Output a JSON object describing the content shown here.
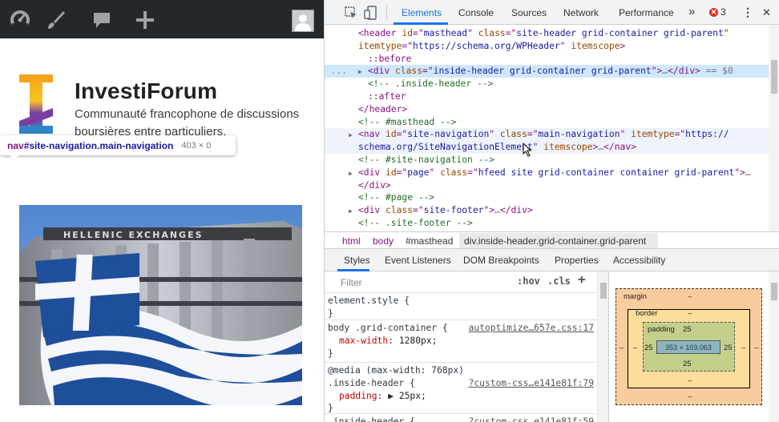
{
  "admin_bar": {
    "icons": [
      "dashboard-icon",
      "customize-brush-icon",
      "comments-icon",
      "new-content-plus-icon"
    ],
    "avatar": "user-avatar"
  },
  "site": {
    "title": "InvestiForum",
    "description": "Communauté francophone de discussions boursières entre particuliers."
  },
  "inspect_tooltip": {
    "tag": "nav",
    "selector": "#site-navigation.main-navigation",
    "dimensions": "403 × 0"
  },
  "hero_image": {
    "building_text": "HELLENIC EXCHANGES",
    "colors": {
      "flag_blue": "#1f4e9a",
      "flag_white": "#f4f6fa",
      "sky": "#6a9ad8"
    }
  },
  "devtools": {
    "tabs": [
      "Elements",
      "Console",
      "Sources",
      "Network",
      "Performance"
    ],
    "active_tab": "Elements",
    "more_label": "»",
    "error_count": "3",
    "menu_label": "⋮",
    "close_label": "✕",
    "dom_lines": [
      {
        "i": 0,
        "tri": "",
        "parts": [
          [
            "t",
            "<header "
          ],
          [
            "a",
            "id"
          ],
          [
            "t",
            "=\""
          ],
          [
            "v",
            "masthead"
          ],
          [
            "t",
            "\" "
          ],
          [
            "a",
            "class"
          ],
          [
            "t",
            "=\""
          ],
          [
            "v",
            "site-header grid-container grid-parent"
          ],
          [
            "t",
            "\""
          ]
        ]
      },
      {
        "i": 0,
        "tri": "",
        "parts": [
          [
            "a",
            "itemtype"
          ],
          [
            "t",
            "=\""
          ],
          [
            "v",
            "https://schema.org/WPHeader"
          ],
          [
            "t",
            "\" "
          ],
          [
            "a",
            "itemscope"
          ],
          [
            "t",
            ">"
          ]
        ]
      },
      {
        "i": 1,
        "tri": "",
        "parts": [
          [
            "p",
            "::before"
          ]
        ]
      },
      {
        "i": 1,
        "tri": "▶",
        "parts": [
          [
            "t",
            "<div "
          ],
          [
            "a",
            "class"
          ],
          [
            "t",
            "=\""
          ],
          [
            "v",
            "inside-header grid-container grid-parent"
          ],
          [
            "t",
            "\">"
          ],
          [
            "g",
            "…"
          ],
          [
            "t",
            "</div>"
          ],
          [
            "g",
            " == $0"
          ]
        ]
      },
      {
        "i": 1,
        "tri": "",
        "parts": [
          [
            "c",
            "<!-- .inside-header -->"
          ]
        ]
      },
      {
        "i": 1,
        "tri": "",
        "parts": [
          [
            "p",
            "::after"
          ]
        ]
      },
      {
        "i": 0,
        "tri": "",
        "parts": [
          [
            "t",
            "</header>"
          ]
        ]
      },
      {
        "i": 0,
        "tri": "",
        "parts": [
          [
            "c",
            "<!-- #masthead -->"
          ]
        ]
      },
      {
        "i": 0,
        "tri": "▶",
        "parts": [
          [
            "t",
            "<nav "
          ],
          [
            "a",
            "id"
          ],
          [
            "t",
            "=\""
          ],
          [
            "v",
            "site-navigation"
          ],
          [
            "t",
            "\" "
          ],
          [
            "a",
            "class"
          ],
          [
            "t",
            "=\""
          ],
          [
            "v",
            "main-navigation"
          ],
          [
            "t",
            "\" "
          ],
          [
            "a",
            "itemtype"
          ],
          [
            "t",
            "=\""
          ],
          [
            "v",
            "https://"
          ]
        ]
      },
      {
        "i": 0,
        "tri": "",
        "parts": [
          [
            "v",
            "schema.org/SiteNavigationElement"
          ],
          [
            "t",
            "\" "
          ],
          [
            "a",
            "itemscope"
          ],
          [
            "t",
            ">"
          ],
          [
            "g",
            "…"
          ],
          [
            "t",
            "</nav>"
          ]
        ]
      },
      {
        "i": 0,
        "tri": "",
        "parts": [
          [
            "c",
            "<!-- #site-navigation -->"
          ]
        ]
      },
      {
        "i": 0,
        "tri": "▶",
        "parts": [
          [
            "t",
            "<div "
          ],
          [
            "a",
            "id"
          ],
          [
            "t",
            "=\""
          ],
          [
            "v",
            "page"
          ],
          [
            "t",
            "\" "
          ],
          [
            "a",
            "class"
          ],
          [
            "t",
            "=\""
          ],
          [
            "v",
            "hfeed site grid-container container grid-parent"
          ],
          [
            "t",
            "\">"
          ],
          [
            "g",
            "…"
          ]
        ]
      },
      {
        "i": 0,
        "tri": "",
        "parts": [
          [
            "t",
            "</div>"
          ]
        ]
      },
      {
        "i": 0,
        "tri": "",
        "parts": [
          [
            "c",
            "<!-- #page -->"
          ]
        ]
      },
      {
        "i": 0,
        "tri": "▶",
        "parts": [
          [
            "t",
            "<div "
          ],
          [
            "a",
            "class"
          ],
          [
            "t",
            "=\""
          ],
          [
            "v",
            "site-footer"
          ],
          [
            "t",
            "\">"
          ],
          [
            "g",
            "…"
          ],
          [
            "t",
            "</div>"
          ]
        ]
      },
      {
        "i": 0,
        "tri": "",
        "parts": [
          [
            "c",
            "<!-- .site-footer -->"
          ]
        ]
      }
    ],
    "breadcrumbs": [
      "html",
      "body",
      "#masthead",
      "div.inside-header.grid-container.grid-parent"
    ],
    "sub_tabs": [
      "Styles",
      "Event Listeners",
      "DOM Breakpoints",
      "Properties",
      "Accessibility"
    ],
    "active_sub_tab": "Styles",
    "styles": {
      "filter_placeholder": "Filter",
      "hov_label": ":hov",
      "cls_label": ".cls",
      "plus_label": "+",
      "rules": [
        {
          "selector": "element.style {",
          "source": "",
          "props": [],
          "close": "}"
        },
        {
          "selector": "body .grid-container {",
          "source": "autoptimize…657e.css:17",
          "props": [
            [
              "max-width",
              "1280px;"
            ]
          ],
          "close": "}"
        },
        {
          "selector": "@media (max-width: 768px)",
          "selector2": ".inside-header {",
          "source": "?custom-css…e141e81f:79",
          "props": [
            [
              "padding",
              "▶ 25px;"
            ]
          ],
          "close": "}"
        },
        {
          "selector": ".inside-header {",
          "source": "?custom-css…e141e81f:59",
          "props": [],
          "close": ""
        }
      ]
    },
    "box_model": {
      "margin_label": "margin",
      "border_label": "border",
      "padding_label": "padding",
      "margin": {
        "top": "–",
        "right": "–",
        "bottom": "–",
        "left": "–"
      },
      "border": {
        "top": "–",
        "right": "–",
        "bottom": "–",
        "left": "–"
      },
      "padding": {
        "top": "25",
        "right": "25",
        "bottom": "25",
        "left": "25"
      },
      "content": "353 × 103.063"
    }
  }
}
